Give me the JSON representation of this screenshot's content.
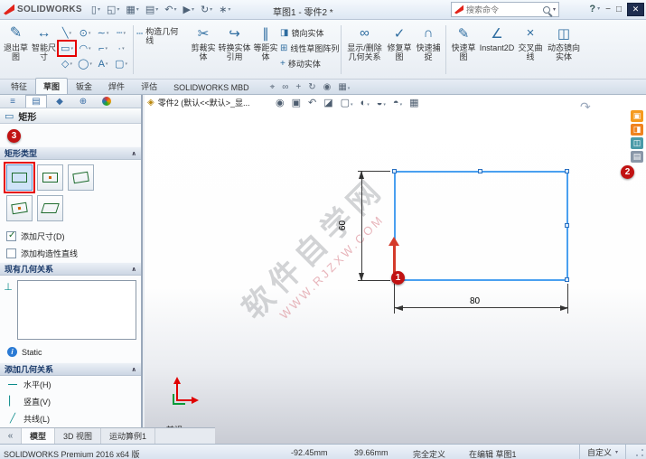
{
  "titlebar": {
    "logo_text": "SOLIDWORKS",
    "doc_title": "草图1 - 零件2 *",
    "search_placeholder": "搜索命令",
    "help_label": "?"
  },
  "icons": {
    "new": "▯",
    "open": "◱",
    "save": "▦",
    "print": "▤",
    "undo": "↶",
    "select": "▶",
    "rebuild": "↻",
    "options": "∗",
    "minimize": "−",
    "maximize": "□",
    "close": "✕",
    "exit_sketch": "✎",
    "smart_dimension": "↔",
    "line": "╲",
    "rectangle": "▭",
    "polygon": "◇",
    "circle": "⊙",
    "arc": "◠",
    "ellipse": "◯",
    "spline": "∼",
    "fillet": "⌐",
    "text": "A",
    "centerline": "┄",
    "point": "·",
    "slot": "▢",
    "construction": "┄",
    "trim": "✂",
    "convert": "↪",
    "offset": "∥",
    "mirror": "◨",
    "pattern": "⊞",
    "move": "+",
    "relations": "∞",
    "repair": "✓",
    "snap": "∩",
    "quick_sketch": "✎",
    "instant2d": "∠",
    "intersection": "×",
    "dyn_mirror": "◫",
    "target": "⌖",
    "glasses": "∞",
    "pan": "+",
    "rotate": "↻",
    "zoom": "◉",
    "monitor": "▦",
    "tree": "≡",
    "pm_page": "▤",
    "config": "◆",
    "dimxpert": "⊕",
    "rect_title": "▭",
    "perpendicular": "⊥",
    "horizontal": "—",
    "vertical": "▏",
    "collinear": "╱",
    "part": "◈",
    "nav_back": "«",
    "zoom_fit": "◉",
    "zoom_area": "▣",
    "prev_view": "↶",
    "section": "◪",
    "orientation": "▢",
    "display_style": "◐",
    "hide_show": "◒",
    "appearance": "◓",
    "scene": "▦",
    "rotate_hint": "↷",
    "fullscreen": "▣",
    "panel2": "◨",
    "panel3": "◫",
    "panel4": "▤",
    "front_dot": "●",
    "info": "i"
  },
  "ribbon": {
    "exit_sketch": "退出草图",
    "smart_dimension": "智能尺寸",
    "buttons": [
      {
        "label": "构造几何线"
      },
      {
        "label": "剪裁实体"
      },
      {
        "label": "转换实体引用"
      },
      {
        "label": "等距实体"
      },
      {
        "label": "镜向实体"
      },
      {
        "label": "线性草图阵列"
      },
      {
        "label": "移动实体"
      },
      {
        "label": "显示/删除几何关系"
      },
      {
        "label": "修复草图"
      },
      {
        "label": "快速捕捉"
      },
      {
        "label": "快速草图"
      },
      {
        "label": "Instant2D"
      },
      {
        "label": "交叉曲线"
      },
      {
        "label": "动态镜向实体"
      }
    ]
  },
  "tabs": {
    "items": [
      "特征",
      "草图",
      "钣金",
      "焊件",
      "评估",
      "SOLIDWORKS MBD"
    ]
  },
  "feature_tree": {
    "root": "零件2 (默认<<默认>_显..."
  },
  "property_panel": {
    "title": "矩形",
    "rect_type_header": "矩形类型",
    "add_dimensions": "添加尺寸(D)",
    "add_construction_lines": "添加构造性直线",
    "existing_relations_header": "现有几何关系",
    "status": "Static",
    "add_relations_header": "添加几何关系",
    "relations": [
      "水平(H)",
      "竖直(V)",
      "共线(L)"
    ]
  },
  "doc_tabs": [
    "模型",
    "3D 视图",
    "运动算例1"
  ],
  "sketch": {
    "dim_height": "60",
    "dim_width": "80",
    "step1": "1",
    "step2": "2",
    "step3": "3",
    "view_label": "前视"
  },
  "watermark": {
    "title": "软件自学网",
    "url": "WWW.RJZXW.COM"
  },
  "statusbar": {
    "product": "SOLIDWORKS Premium 2016 x64 版",
    "coord_x": "-92.45mm",
    "coord_y": "39.66mm",
    "definition": "完全定义",
    "editing": "在编辑 草图1",
    "units": "自定义"
  }
}
